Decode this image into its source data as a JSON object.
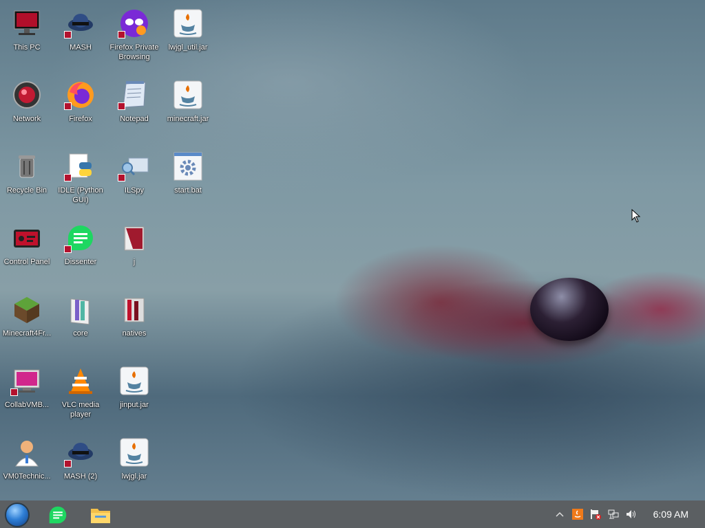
{
  "desktop": {
    "icons": [
      {
        "label": "This PC",
        "icon": "computer-icon"
      },
      {
        "label": "Network",
        "icon": "network-icon"
      },
      {
        "label": "Recycle Bin",
        "icon": "recycle-bin-icon"
      },
      {
        "label": "Control Panel",
        "icon": "control-panel-icon"
      },
      {
        "label": "Minecraft4Fr...",
        "icon": "minecraft-icon"
      },
      {
        "label": "CollabVMB...",
        "icon": "collabvm-icon"
      },
      {
        "label": "VM0Technic...",
        "icon": "technician-icon"
      },
      {
        "label": "MASH",
        "icon": "mash-icon"
      },
      {
        "label": "Firefox",
        "icon": "firefox-icon"
      },
      {
        "label": "IDLE (Python GUI)",
        "icon": "python-icon"
      },
      {
        "label": "Dissenter",
        "icon": "dissenter-icon"
      },
      {
        "label": "core",
        "icon": "folder-icon"
      },
      {
        "label": "VLC media player",
        "icon": "vlc-icon"
      },
      {
        "label": "MASH (2)",
        "icon": "mash-icon"
      },
      {
        "label": "Firefox Private Browsing",
        "icon": "firefox-private-icon"
      },
      {
        "label": "Notepad",
        "icon": "notepad-icon"
      },
      {
        "label": "ILSpy",
        "icon": "ilspy-icon"
      },
      {
        "label": "j",
        "icon": "folder-icon"
      },
      {
        "label": "natives",
        "icon": "folder-icon"
      },
      {
        "label": "jinput.jar",
        "icon": "java-icon"
      },
      {
        "label": "lwjgl.jar",
        "icon": "java-icon"
      },
      {
        "label": "lwjgl_util.jar",
        "icon": "java-icon"
      },
      {
        "label": "minecraft.jar",
        "icon": "java-icon"
      },
      {
        "label": "start.bat",
        "icon": "batch-file-icon"
      }
    ]
  },
  "taskbar": {
    "start": "start-orb-icon",
    "pinned": [
      "dissenter-icon",
      "file-explorer-icon"
    ],
    "tray": [
      "show-hidden-icons-icon",
      "java-update-icon",
      "action-center-flag-icon",
      "network-icon",
      "volume-icon"
    ],
    "clock": "6:09 AM"
  },
  "colors": {
    "taskbar": "#5b5f62",
    "shortcut_badge": "#b3122e",
    "dissenter_green": "#1ed761"
  }
}
